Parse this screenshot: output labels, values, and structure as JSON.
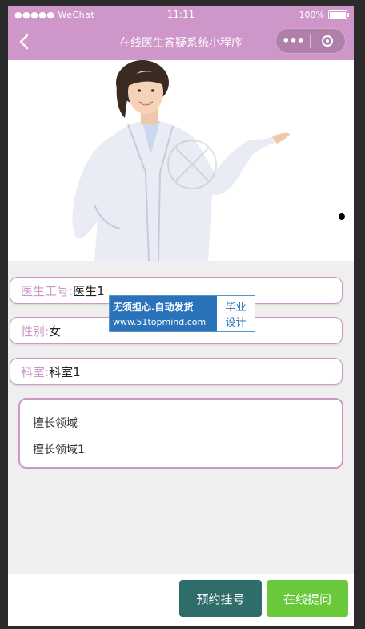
{
  "status_bar": {
    "carrier": "●●●●● WeChat",
    "time": "11:11",
    "battery": "100%"
  },
  "nav": {
    "title": "在线医生答疑系统小程序",
    "menu_dots": "•••"
  },
  "doctor": {
    "id_label": "医生工号:",
    "id_value": "医生1",
    "gender_label": "性别:",
    "gender_value": "女",
    "dept_label": "科室:",
    "dept_value": "科室1",
    "specialty_label": "擅长领域",
    "specialty_value": "擅长领域1"
  },
  "watermark": {
    "line1": "无须担心.自动发货",
    "line2": "www.51topmind.com",
    "right1": "毕业",
    "right2": "设计"
  },
  "actions": {
    "book_label": "预约挂号",
    "ask_label": "在线提问"
  },
  "colors": {
    "theme": "#cf97c9",
    "book": "#2f6d6a",
    "ask": "#69c93a"
  }
}
